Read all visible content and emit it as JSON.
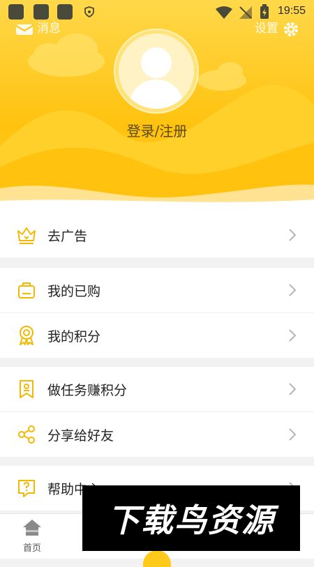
{
  "status_bar": {
    "time": "19:55"
  },
  "header": {
    "messages_label": "消息",
    "settings_label": "设置",
    "login_text": "登录/注册"
  },
  "colors": {
    "accent": "#ffc20e",
    "icon": "#f5b800",
    "background": "#f2f2f2"
  },
  "menu": {
    "groups": [
      {
        "items": [
          {
            "label": "去广告",
            "icon": "crown-icon"
          }
        ]
      },
      {
        "items": [
          {
            "label": "我的已购",
            "icon": "bag-icon"
          },
          {
            "label": "我的积分",
            "icon": "medal-icon"
          }
        ]
      },
      {
        "items": [
          {
            "label": "做任务赚积分",
            "icon": "bookmark-icon"
          },
          {
            "label": "分享给好友",
            "icon": "share-icon"
          }
        ]
      },
      {
        "items": [
          {
            "label": "帮助中心",
            "icon": "help-icon"
          }
        ]
      }
    ]
  },
  "bottom_nav": {
    "home_label": "首页"
  },
  "watermark": {
    "text": "下载鸟资源"
  }
}
